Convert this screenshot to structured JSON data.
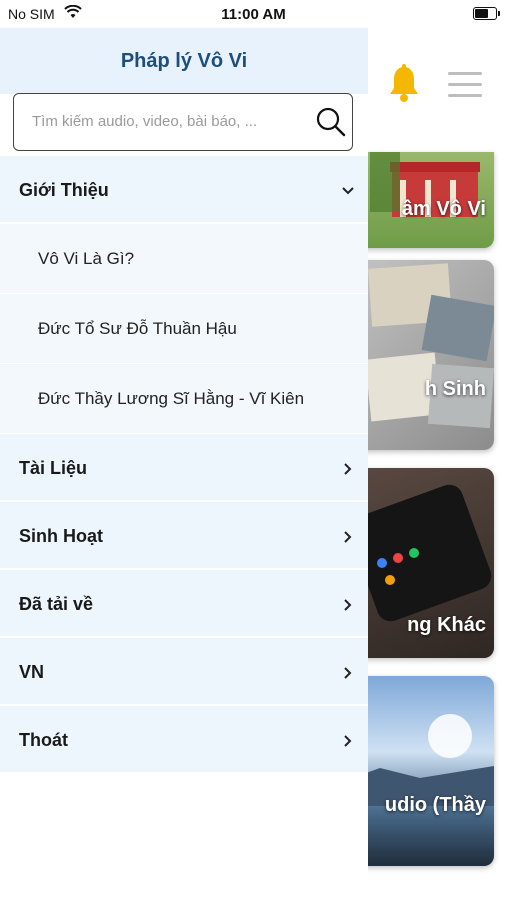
{
  "status_bar": {
    "carrier": "No SIM",
    "time": "11:00 AM"
  },
  "drawer": {
    "title": "Pháp lý Vô Vi",
    "search_placeholder": "Tìm kiếm audio, video, bài báo, ...",
    "sections": [
      {
        "label": "Giới Thiệu",
        "expanded": true,
        "children": [
          "Vô Vi Là Gì?",
          "Đức Tổ Sư Đỗ Thuần Hậu",
          "Đức Thầy Lương Sĩ Hằng - Vĩ Kiên"
        ]
      },
      {
        "label": "Tài Liệu"
      },
      {
        "label": "Sinh Hoạt"
      },
      {
        "label": "Đã tải về"
      },
      {
        "label": "VN"
      },
      {
        "label": "Thoát"
      }
    ]
  },
  "background": {
    "cards": [
      "âm Vô Vi",
      "h Sinh",
      "ng Khác",
      "udio (Thầy"
    ]
  },
  "colors": {
    "header_bg": "#e8f2fc",
    "title": "#1e4e7a",
    "bell": "#f5b800",
    "menu_bg": "#eef6fd"
  }
}
